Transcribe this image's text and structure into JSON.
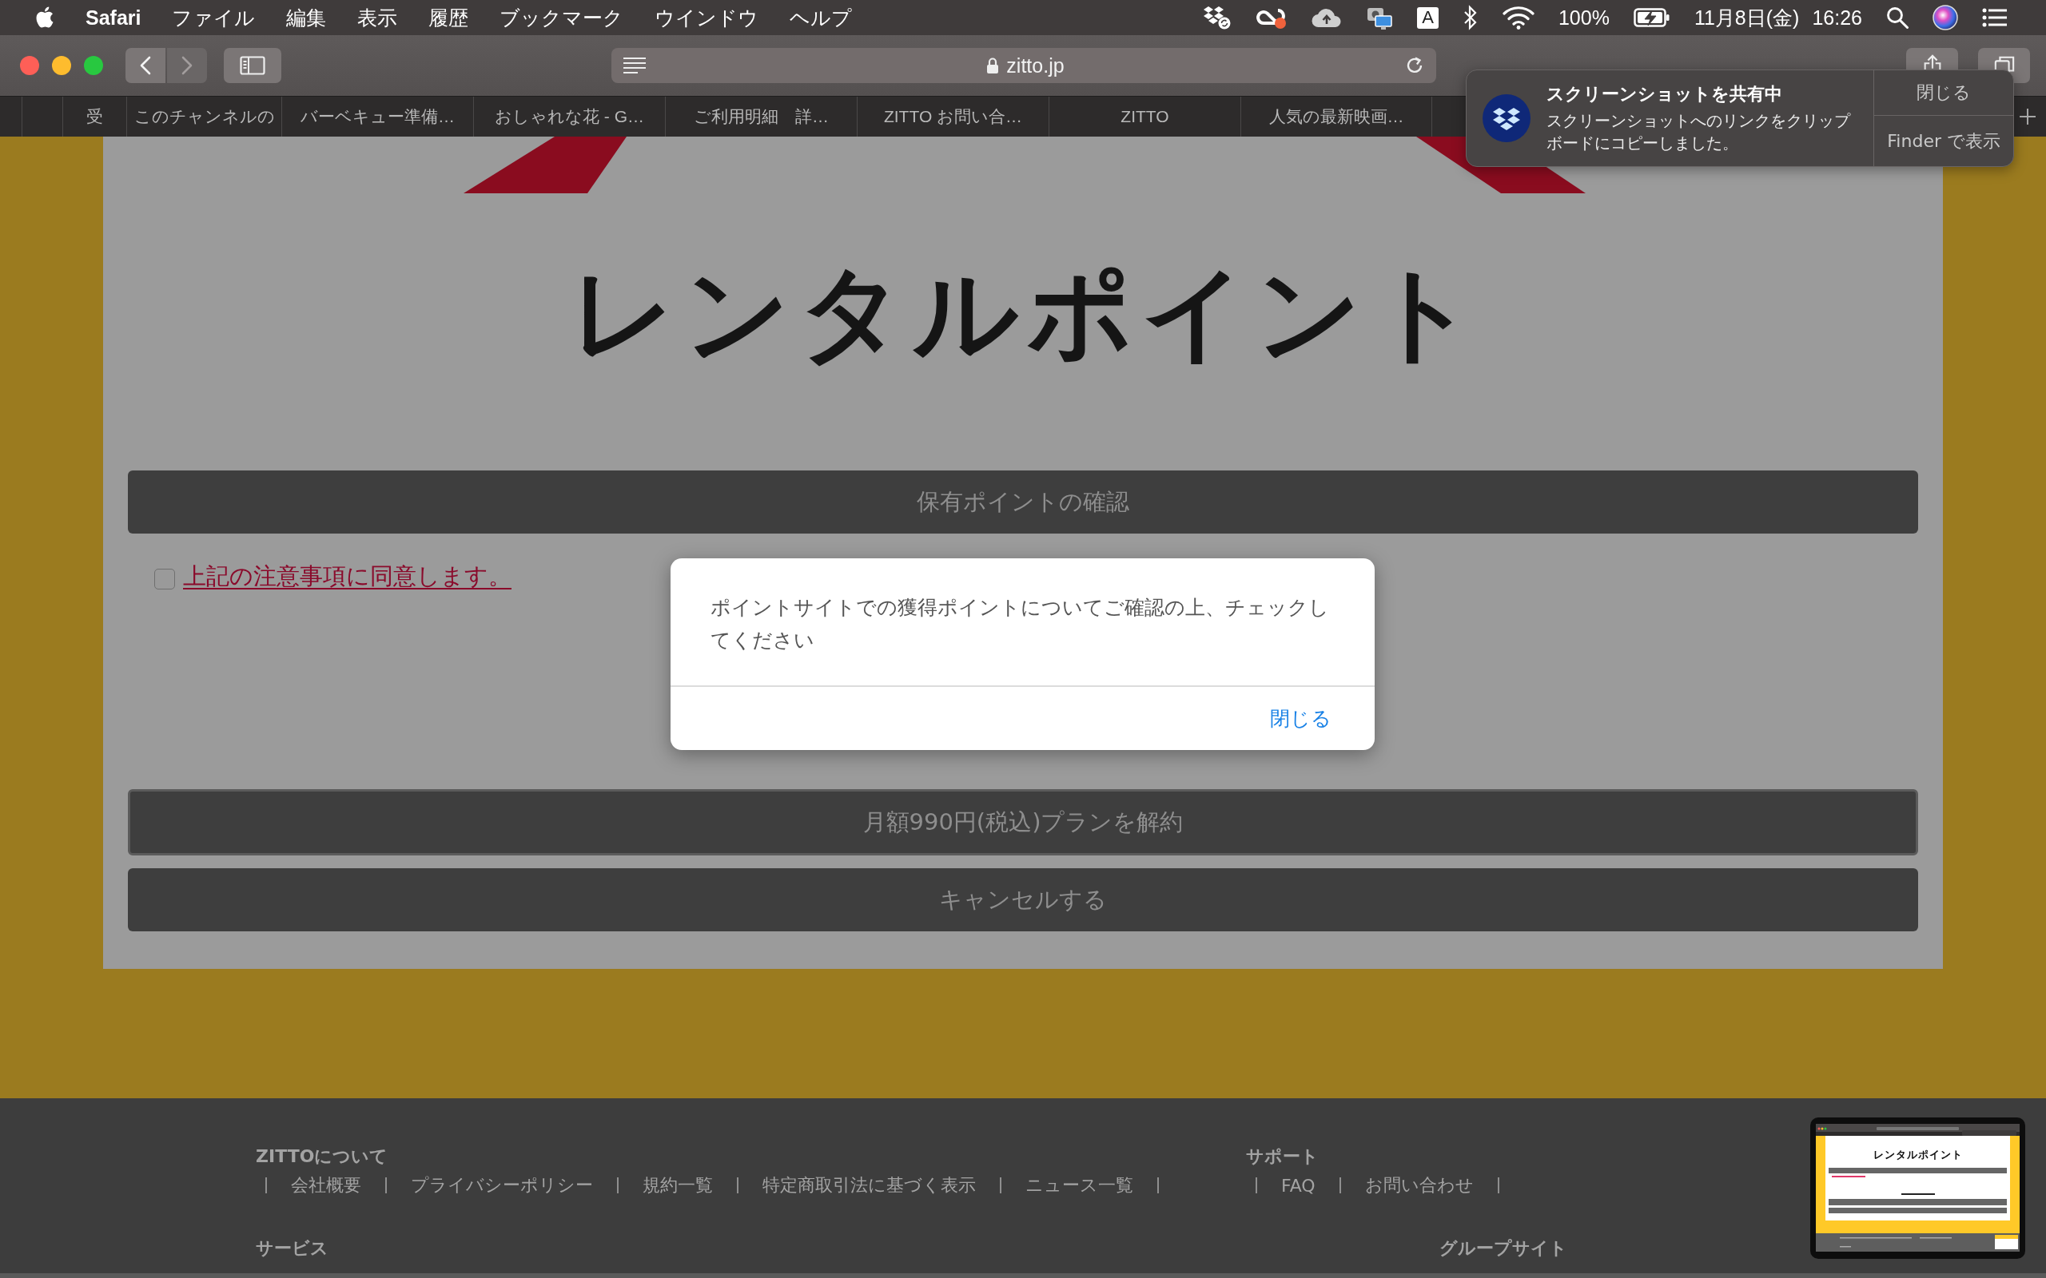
{
  "menu_bar": {
    "app_name": "Safari",
    "menus": [
      "ファイル",
      "編集",
      "表示",
      "履歴",
      "ブックマーク",
      "ウインドウ",
      "ヘルプ"
    ],
    "input_source": "A",
    "battery_percent": "100%",
    "date": "11月8日(金)",
    "time": "16:26"
  },
  "toolbar": {
    "nav_buttons": [
      {
        "kind": "back",
        "disabled": false
      },
      {
        "kind": "forward",
        "disabled": true
      }
    ],
    "address": "zitto.jp"
  },
  "tabs": [
    {
      "label": "受",
      "selected": false
    },
    {
      "label": "このチャンネルの",
      "selected": false
    },
    {
      "label": "バーベキュー準備…",
      "selected": false
    },
    {
      "label": "おしゃれな花 - G…",
      "selected": false
    },
    {
      "label": "ご利用明細　詳…",
      "selected": false
    },
    {
      "label": "ZITTO お問い合…",
      "selected": false
    },
    {
      "label": "ZITTO",
      "selected": false
    },
    {
      "label": "人気の最新映画…",
      "selected": false
    }
  ],
  "notification": {
    "title": "スクリーンショットを共有中",
    "body": "スクリーンショットへのリンクをクリップボードにコピーしました。",
    "actions": [
      "閉じる",
      "Finder で表示"
    ]
  },
  "page": {
    "title": "レンタルポイント",
    "check_button": "保有ポイントの確認",
    "agreement": {
      "label": "上記の注意事項に同意します。",
      "checked": false
    },
    "actions": [
      {
        "label": "月額990円(税込)プランを解約",
        "focused": true
      },
      {
        "label": "キャンセルする",
        "focused": false
      }
    ]
  },
  "dialog": {
    "message": "ポイントサイトでの獲得ポイントについてご確認の上、チェックしてください",
    "button": "閉じる"
  },
  "footer": {
    "sections": [
      {
        "heading": "ZITTOについて",
        "links": [
          "会社概要",
          "プライバシーポリシー",
          "規約一覧",
          "特定商取引法に基づく表示",
          "ニュース一覧"
        ]
      },
      {
        "heading": "サポート",
        "links": [
          "FAQ",
          "お問い合わせ"
        ]
      },
      {
        "heading": "サービス"
      },
      {
        "heading": "グループサイト"
      }
    ]
  },
  "thumbnail": {
    "title": "レンタルポイント"
  }
}
